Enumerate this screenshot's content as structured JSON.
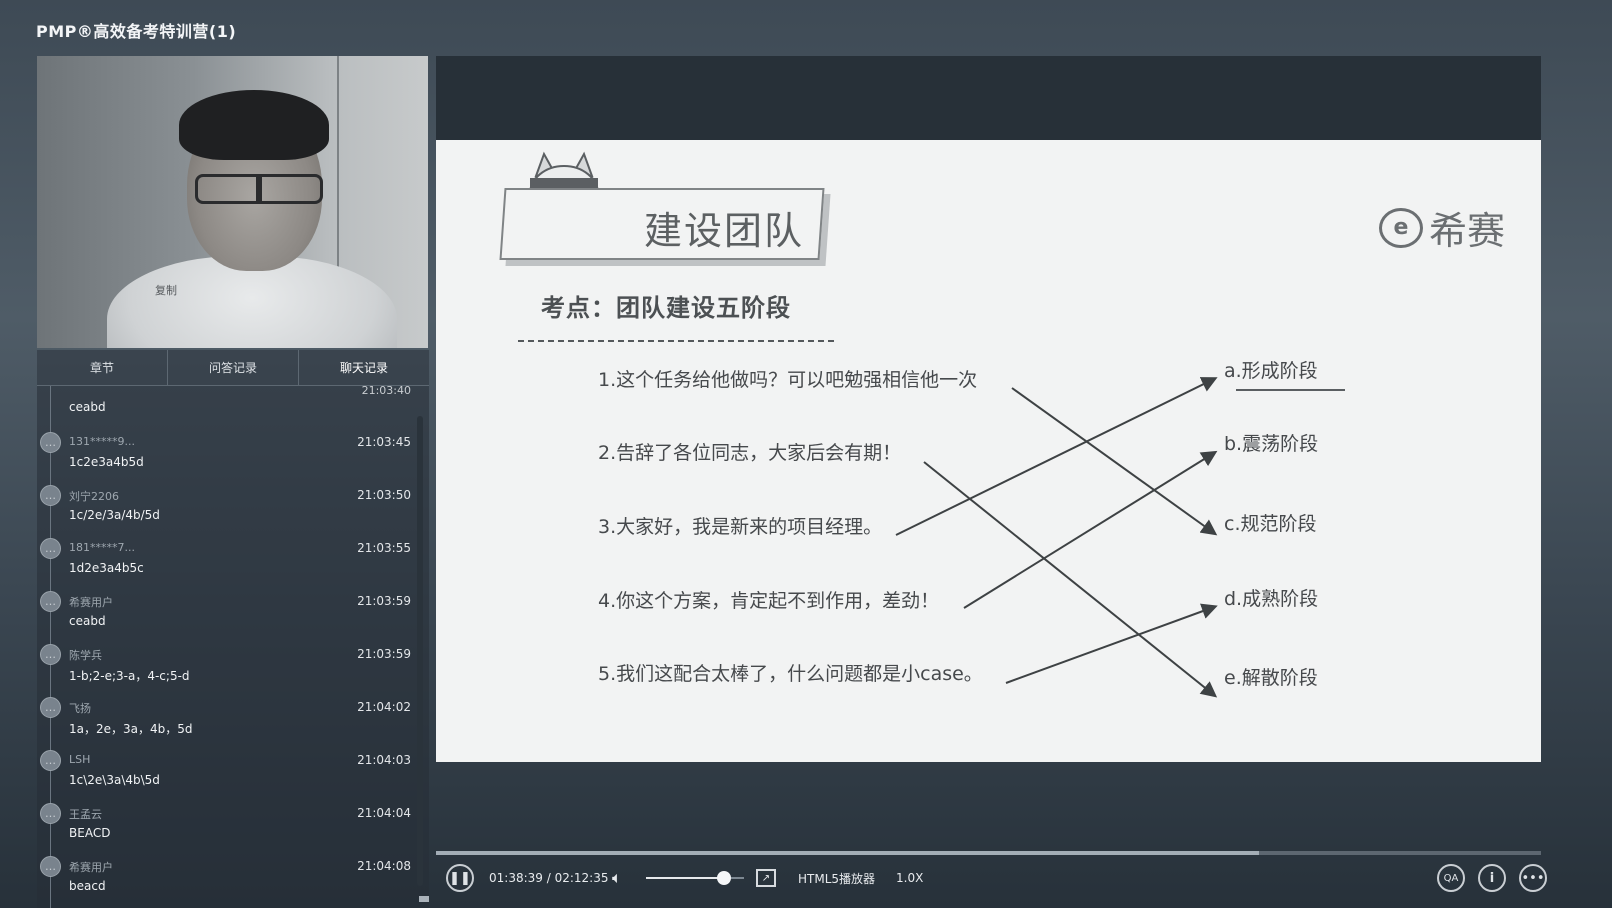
{
  "app": {
    "title": "PMP®高效备考特训营(1)"
  },
  "webcam": {
    "overlay_text": "复制"
  },
  "chat": {
    "tabs": [
      {
        "label": "章节"
      },
      {
        "label": "问答记录"
      },
      {
        "label": "聊天记录"
      }
    ],
    "first_partial": {
      "time": "21:03:40",
      "message": "ceabd"
    },
    "items": [
      {
        "user": "131*****9...",
        "time": "21:03:45",
        "message": "1c2e3a4b5d"
      },
      {
        "user": "刘宁2206",
        "time": "21:03:50",
        "message": "1c/2e/3a/4b/5d"
      },
      {
        "user": "181*****7...",
        "time": "21:03:55",
        "message": "1d2e3a4b5c"
      },
      {
        "user": "希赛用户",
        "time": "21:03:59",
        "message": "ceabd"
      },
      {
        "user": "陈学兵",
        "time": "21:03:59",
        "message": "1-b;2-e;3-a，4-c;5-d"
      },
      {
        "user": "飞扬",
        "time": "21:04:02",
        "message": "1a，2e，3a，4b，5d"
      },
      {
        "user": "LSH",
        "time": "21:04:03",
        "message": "1c\\2e\\3a\\4b\\5d"
      },
      {
        "user": "王孟云",
        "time": "21:04:04",
        "message": "BEACD"
      },
      {
        "user": "希赛用户",
        "time": "21:04:08",
        "message": "beacd"
      }
    ]
  },
  "slide": {
    "title": "建设团队",
    "logo_text": "希赛",
    "logo_mark": "e",
    "topic": "考点：团队建设五阶段",
    "statements": [
      "1.这个任务给他做吗？可以吧勉强相信他一次",
      "2.告辞了各位同志，大家后会有期！",
      "3.大家好，我是新来的项目经理。",
      "4.你这个方案，肯定起不到作用，差劲！",
      "5.我们这配合太棒了，什么问题都是小case。"
    ],
    "options": [
      "a.形成阶段",
      "b.震荡阶段",
      "c.规范阶段",
      "d.成熟阶段",
      "e.解散阶段"
    ],
    "matches": [
      {
        "from": 1,
        "to": "c"
      },
      {
        "from": 2,
        "to": "e"
      },
      {
        "from": 3,
        "to": "a"
      },
      {
        "from": 4,
        "to": "b"
      },
      {
        "from": 5,
        "to": "d"
      }
    ]
  },
  "player": {
    "time_display": "01:38:39 / 02:12:35",
    "player_label": "HTML5播放器",
    "speed": "1.0X",
    "progress": 0.745,
    "volume": 0.8
  }
}
